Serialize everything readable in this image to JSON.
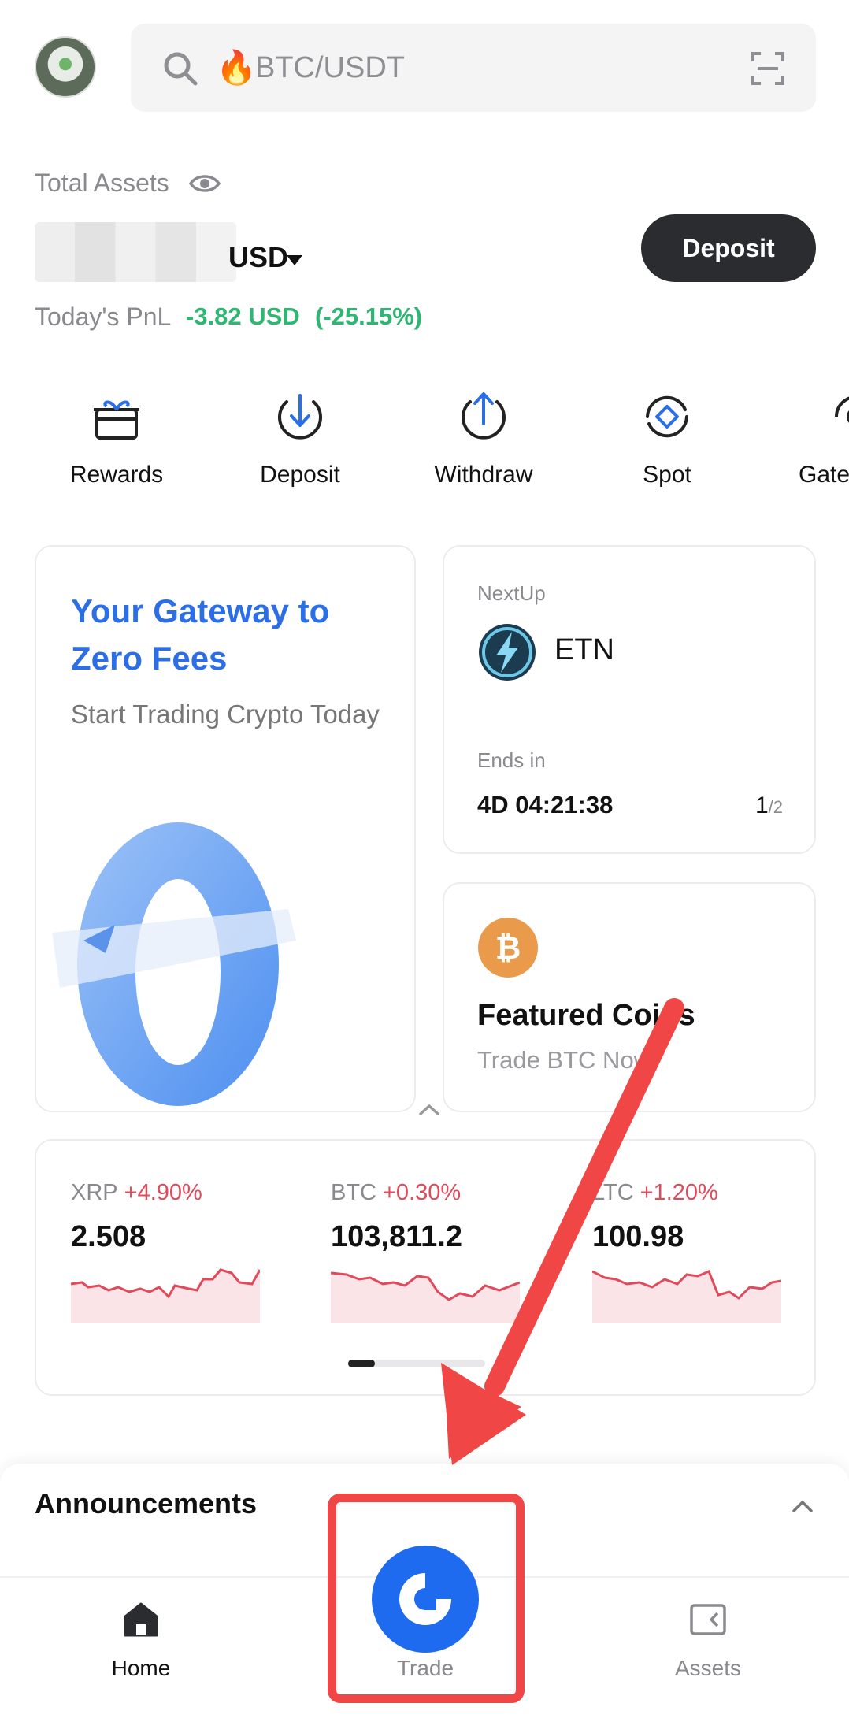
{
  "search": {
    "placeholder": "BTC/USDT",
    "icon": "search-icon",
    "fire_icon": "fire-icon",
    "scan_icon": "scan-icon"
  },
  "assets": {
    "label": "Total Assets",
    "currency": "USD",
    "deposit_button": "Deposit",
    "pnl_label": "Today's PnL",
    "pnl_value": "-3.82 USD",
    "pnl_percent": "(-25.15%)",
    "pnl_color": "#2fb672"
  },
  "shortcuts": [
    {
      "label": "Rewards",
      "icon": "gift-icon"
    },
    {
      "label": "Deposit",
      "icon": "deposit-arrow-icon"
    },
    {
      "label": "Withdraw",
      "icon": "withdraw-arrow-icon"
    },
    {
      "label": "Spot",
      "icon": "spot-icon"
    },
    {
      "label": "Gate",
      "icon": "gate-icon"
    }
  ],
  "promo": {
    "title": "Your Gateway to Zero Fees",
    "subtitle": "Start Trading Crypto Today",
    "accent": "#2b6ee6"
  },
  "nextup": {
    "label": "NextUp",
    "coin": "ETN",
    "ends_label": "Ends in",
    "timer": "4D 04:21:38",
    "page_current": "1",
    "page_total": "/2"
  },
  "featured": {
    "title": "Featured Coins",
    "subtitle": "Trade BTC Now"
  },
  "tickers": [
    {
      "symbol": "XRP",
      "change": "+4.90%",
      "price": "2.508"
    },
    {
      "symbol": "BTC",
      "change": "+0.30%",
      "price": "103,811.2"
    },
    {
      "symbol": "LTC",
      "change": "+1.20%",
      "price": "100.98"
    }
  ],
  "announcements": {
    "title": "Announcements"
  },
  "nav": {
    "home": "Home",
    "trade": "Trade",
    "assets": "Assets"
  },
  "colors": {
    "brand_blue": "#1f6bf0",
    "negative": "#e04a5a",
    "annotation_red": "#f04646"
  }
}
